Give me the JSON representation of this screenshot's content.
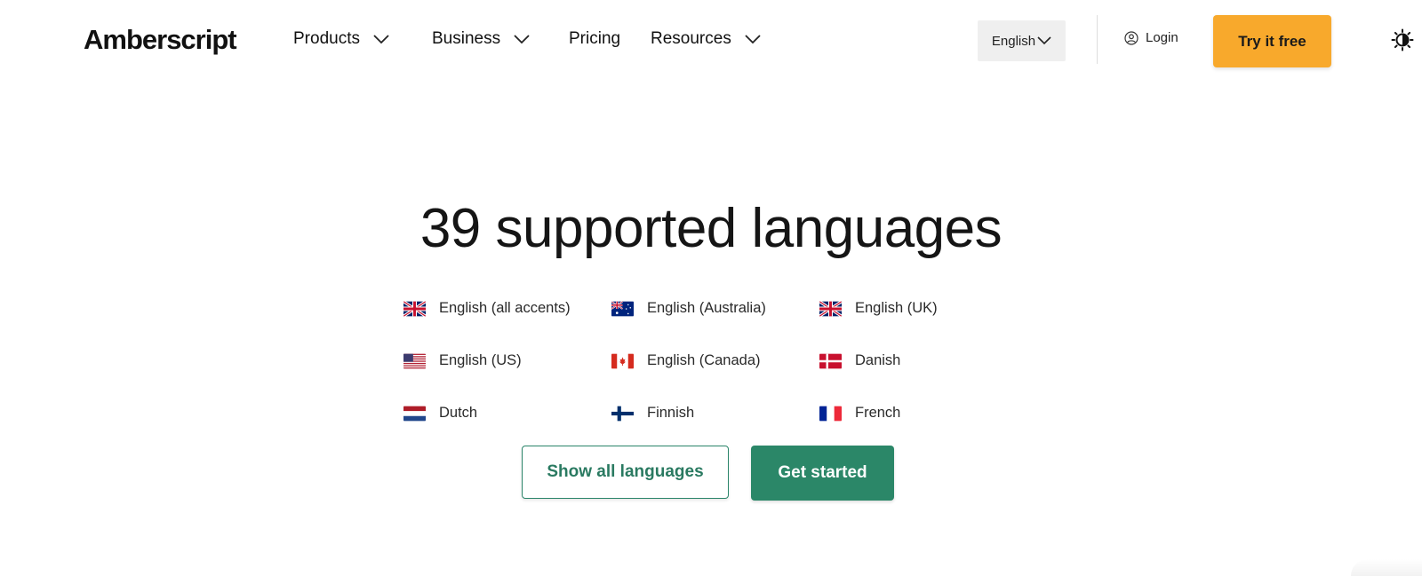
{
  "header": {
    "logo": "Amberscript",
    "nav": [
      {
        "label": "Products",
        "has_dropdown": true
      },
      {
        "label": "Business",
        "has_dropdown": true
      },
      {
        "label": "Pricing",
        "has_dropdown": false
      },
      {
        "label": "Resources",
        "has_dropdown": true
      }
    ],
    "language_select": "English",
    "login": "Login",
    "cta": "Try it free",
    "cta_color": "#f8a92c",
    "theme_icon": "contrast-icon"
  },
  "hero": {
    "title": "39 supported languages",
    "languages": [
      {
        "label": "English (all accents)",
        "flag": "uk-flag-icon"
      },
      {
        "label": "English (Australia)",
        "flag": "australia-flag-icon"
      },
      {
        "label": "English (UK)",
        "flag": "uk-flag-icon"
      },
      {
        "label": "English (US)",
        "flag": "us-flag-icon"
      },
      {
        "label": "English (Canada)",
        "flag": "canada-flag-icon"
      },
      {
        "label": "Danish",
        "flag": "denmark-flag-icon"
      },
      {
        "label": "Dutch",
        "flag": "netherlands-flag-icon"
      },
      {
        "label": "Finnish",
        "flag": "finland-flag-icon"
      },
      {
        "label": "French",
        "flag": "france-flag-icon"
      }
    ],
    "show_all_button": "Show all languages",
    "get_started_button": "Get started",
    "accent_color": "#2b8768"
  }
}
